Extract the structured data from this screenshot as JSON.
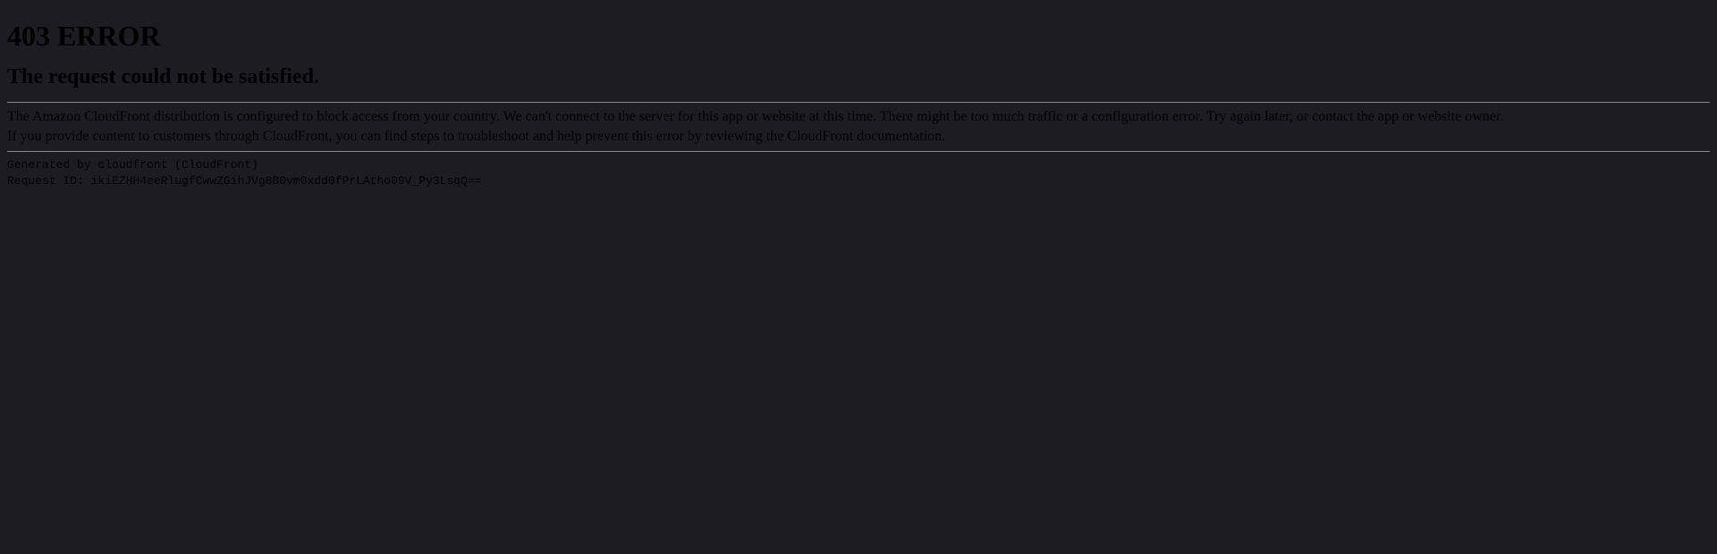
{
  "error": {
    "title": "403 ERROR",
    "subtitle": "The request could not be satisfied.",
    "message1": "The Amazon CloudFront distribution is configured to block access from your country. We can't connect to the server for this app or website at this time. There might be too much traffic or a configuration error. Try again later, or contact the app or website owner.",
    "message2": "If you provide content to customers through CloudFront, you can find steps to troubleshoot and help prevent this error by reviewing the CloudFront documentation.",
    "generated_by": "Generated by cloudfront (CloudFront)",
    "request_id": "Request ID: ikiEZHH4eeRlugfCwwZGihJVg8B0vm0xdd0fPrLAtho09V_Py3LsqQ=="
  }
}
